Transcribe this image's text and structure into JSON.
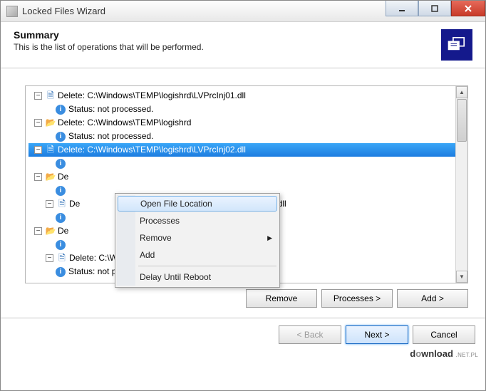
{
  "window": {
    "title": "Locked Files Wizard"
  },
  "header": {
    "heading": "Summary",
    "subtext": "This is the list of operations that will be performed."
  },
  "tree": {
    "items": [
      {
        "level": 1,
        "type": "file",
        "label": "Delete: C:\\Windows\\TEMP\\logishrd\\LVPrcInj01.dll",
        "selected": false
      },
      {
        "level": 2,
        "type": "status",
        "label": "Status: not processed."
      },
      {
        "level": 1,
        "type": "folder",
        "label": "Delete: C:\\Windows\\TEMP\\logishrd",
        "selected": false
      },
      {
        "level": 2,
        "type": "status",
        "label": "Status: not processed."
      },
      {
        "level": 1,
        "type": "file",
        "label": "Delete: C:\\Windows\\TEMP\\logishrd\\LVPrcInj02.dll",
        "selected": true
      },
      {
        "level": 2,
        "type": "status",
        "label": ""
      },
      {
        "level": 1,
        "type": "folder",
        "label": "De",
        "selected": false
      },
      {
        "level": 2,
        "type": "status",
        "label": ""
      },
      {
        "level": 3,
        "type": "file",
        "label": "De",
        "tail": "PrcInj01.dll",
        "selected": false
      },
      {
        "level": 2,
        "type": "status",
        "label": ""
      },
      {
        "level": 1,
        "type": "folder",
        "label": "De",
        "selected": false
      },
      {
        "level": 2,
        "type": "status",
        "label": ""
      },
      {
        "level": 3,
        "type": "file",
        "label": "Delete: C:\\Windows\\TEMP\\logishrd\\LVPrcInj02.dll",
        "selected": false
      },
      {
        "level": 2,
        "type": "status",
        "label": "Status: not processed."
      }
    ]
  },
  "row_buttons": {
    "remove": "Remove",
    "processes": "Processes >",
    "add": "Add >"
  },
  "context_menu": {
    "items": [
      {
        "label": "Open File Location",
        "highlight": true
      },
      {
        "label": "Processes"
      },
      {
        "label": "Remove",
        "submenu": true
      },
      {
        "label": "Add"
      },
      {
        "sep": true
      },
      {
        "label": "Delay Until Reboot"
      }
    ]
  },
  "footer": {
    "back": "< Back",
    "next": "Next >",
    "cancel": "Cancel"
  },
  "watermark": {
    "pre": "d",
    "mid": "o",
    "post": "wnload",
    "suffix": ".NET.PL"
  }
}
